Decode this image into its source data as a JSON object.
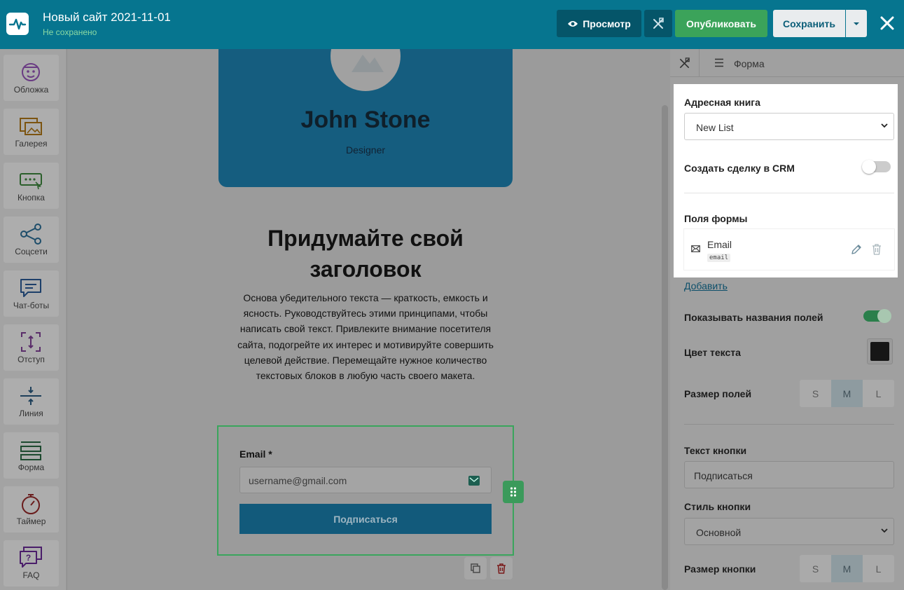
{
  "header": {
    "site_title": "Новый сайт 2021-11-01",
    "save_status": "Не сохранено",
    "preview_label": "Просмотр",
    "publish_label": "Опубликовать",
    "save_label": "Сохранить"
  },
  "sidebar": {
    "items": [
      {
        "label": "Обложка",
        "icon": "cover-icon"
      },
      {
        "label": "Галерея",
        "icon": "gallery-icon"
      },
      {
        "label": "Кнопка",
        "icon": "button-block-icon"
      },
      {
        "label": "Соцсети",
        "icon": "share-icon"
      },
      {
        "label": "Чат-боты",
        "icon": "chat-icon"
      },
      {
        "label": "Отступ",
        "icon": "spacing-icon"
      },
      {
        "label": "Линия",
        "icon": "line-icon"
      },
      {
        "label": "Форма",
        "icon": "form-icon"
      },
      {
        "label": "Таймер",
        "icon": "timer-icon"
      },
      {
        "label": "FAQ",
        "icon": "faq-icon"
      }
    ]
  },
  "canvas": {
    "profile_name": "John Stone",
    "profile_role": "Designer",
    "headline": "Придумайте свой заголовок",
    "body_text": "Основа убедительного текста — краткость, емкость и ясность. Руководствуйтесь этими принципами, чтобы написать свой текст. Привлеките внимание посетителя сайта, подогрейте их интерес и мотивируйте совершить целевой действие. Перемещайте нужное количество текстовых блоков в любую часть своего макета.",
    "form": {
      "email_label": "Email *",
      "email_placeholder": "username@gmail.com",
      "submit_label": "Подписаться"
    }
  },
  "panel": {
    "breadcrumb": "Форма",
    "address_book_label": "Адресная книга",
    "address_book_value": "New List",
    "create_deal_label": "Создать сделку в CRM",
    "create_deal_on": false,
    "form_fields_label": "Поля формы",
    "fields": [
      {
        "name": "Email",
        "key": "email"
      }
    ],
    "add_label": "Добавить",
    "show_names_label": "Показывать названия полей",
    "show_names_on": true,
    "text_color_label": "Цвет текста",
    "text_color": "#161616",
    "field_size_label": "Размер полей",
    "sizes": [
      "S",
      "M",
      "L"
    ],
    "field_size_selected": "M",
    "button_text_label": "Текст кнопки",
    "button_text_value": "Подписаться",
    "button_style_label": "Стиль кнопки",
    "button_style_value": "Основной",
    "button_size_label": "Размер кнопки",
    "button_size_selected": "M"
  },
  "colors": {
    "topbar": "#06758f",
    "publish": "#3ba35a",
    "form_selection": "#3aa55c"
  }
}
